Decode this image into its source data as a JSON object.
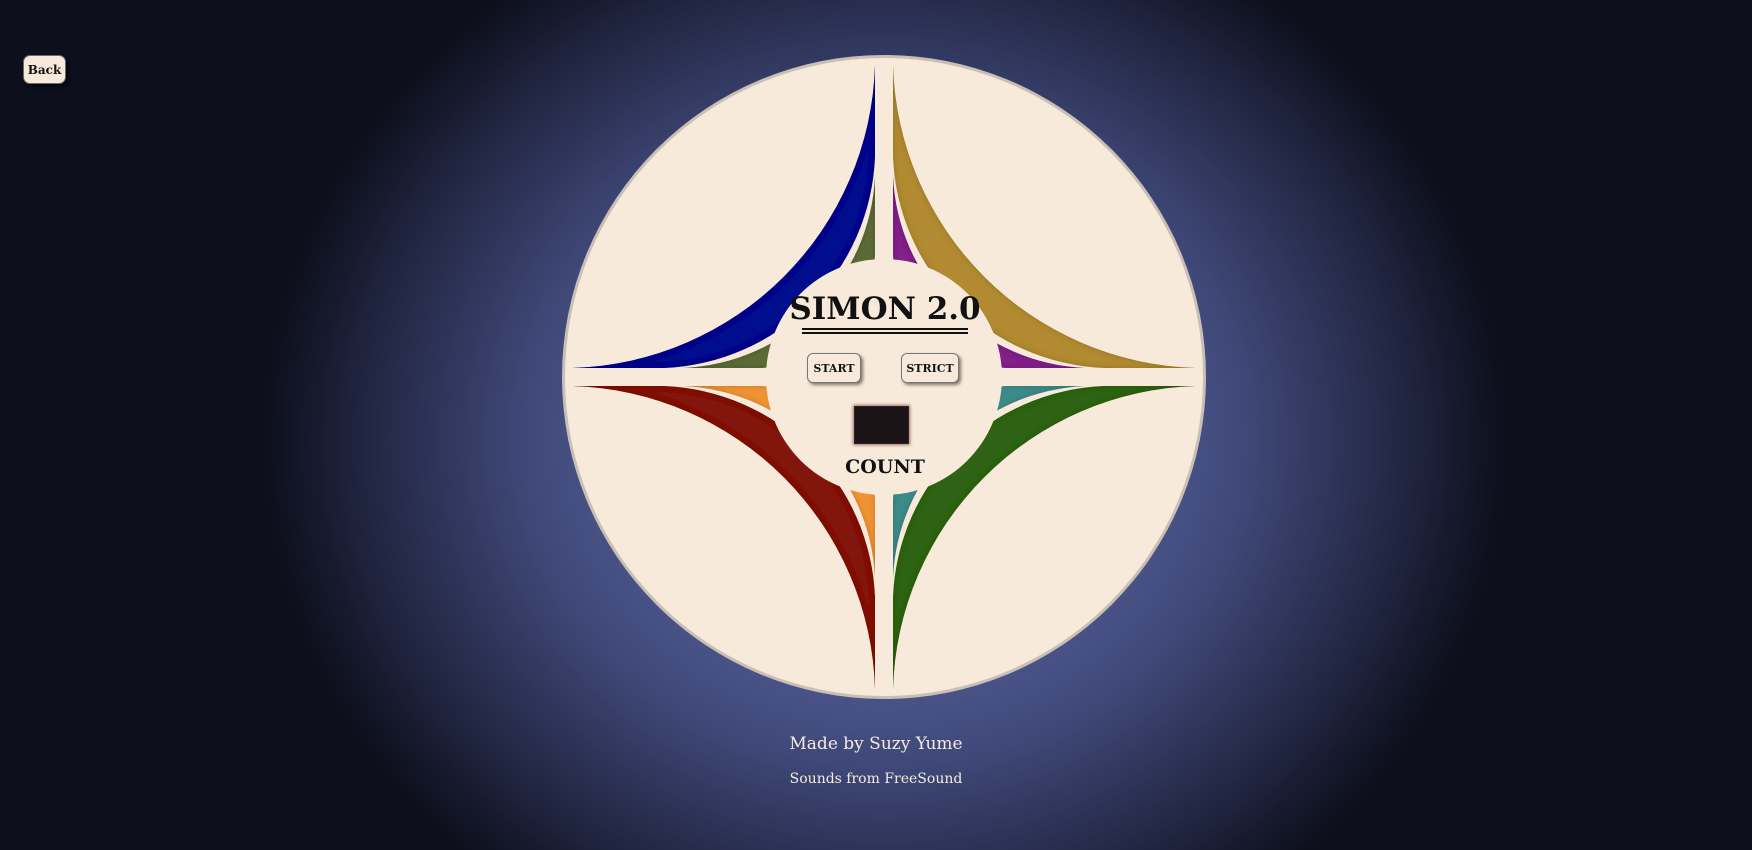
{
  "nav": {
    "back_label": "Back"
  },
  "game": {
    "title": "SIMON 2.0",
    "start_label": "START",
    "strict_label": "STRICT",
    "count_value": "",
    "count_label": "COUNT"
  },
  "pads": {
    "outer_top_left": {
      "color": "#020f8c"
    },
    "outer_top_right": {
      "color": "#b18a32"
    },
    "outer_bottom_left": {
      "color": "#821810"
    },
    "outer_bottom_right": {
      "color": "#2d6316"
    },
    "inner_top_left": {
      "color": "#5b6b38"
    },
    "inner_top_right": {
      "color": "#822089"
    },
    "inner_bottom_left": {
      "color": "#ef9336"
    },
    "inner_bottom_right": {
      "color": "#3c8b89"
    }
  },
  "colors": {
    "board_cream": "#f8eadb",
    "background_center": "#6370a8",
    "background_edge": "#0d0f1c"
  },
  "footer": {
    "author": "Made by Suzy Yume",
    "sounds": "Sounds from FreeSound"
  }
}
